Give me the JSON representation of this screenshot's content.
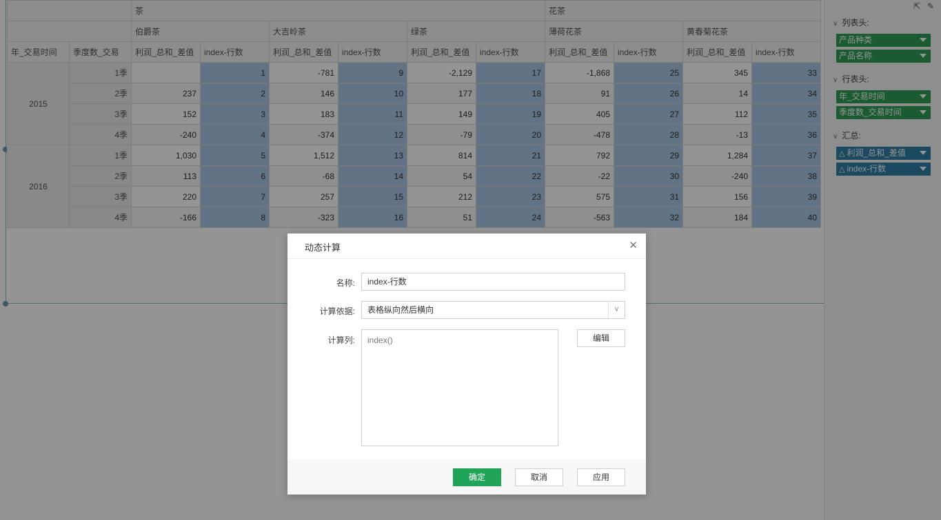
{
  "pivot": {
    "top_groups": [
      "茶",
      "花茶"
    ],
    "products": [
      "伯爵茶",
      "大吉岭茶",
      "绿茶",
      "薄荷花茶",
      "黄春菊花茶"
    ],
    "row_fields": [
      "年_交易时间",
      "季度数_交易"
    ],
    "measure_labels": [
      "利润_总和_差值",
      "index-行数"
    ],
    "years": [
      "2015",
      "2016"
    ],
    "quarters": [
      "1季",
      "2季",
      "3季",
      "4季"
    ],
    "rows": [
      [
        [
          "",
          "1"
        ],
        [
          "-781",
          "9"
        ],
        [
          "-2,129",
          "17"
        ],
        [
          "-1,868",
          "25"
        ],
        [
          "345",
          "33"
        ]
      ],
      [
        [
          "237",
          "2"
        ],
        [
          "146",
          "10"
        ],
        [
          "177",
          "18"
        ],
        [
          "91",
          "26"
        ],
        [
          "14",
          "34"
        ]
      ],
      [
        [
          "152",
          "3"
        ],
        [
          "183",
          "11"
        ],
        [
          "149",
          "19"
        ],
        [
          "405",
          "27"
        ],
        [
          "112",
          "35"
        ]
      ],
      [
        [
          "-240",
          "4"
        ],
        [
          "-374",
          "12"
        ],
        [
          "-79",
          "20"
        ],
        [
          "-478",
          "28"
        ],
        [
          "-13",
          "36"
        ]
      ],
      [
        [
          "1,030",
          "5"
        ],
        [
          "1,512",
          "13"
        ],
        [
          "814",
          "21"
        ],
        [
          "792",
          "29"
        ],
        [
          "1,284",
          "37"
        ]
      ],
      [
        [
          "113",
          "6"
        ],
        [
          "-68",
          "14"
        ],
        [
          "54",
          "22"
        ],
        [
          "-22",
          "30"
        ],
        [
          "-240",
          "38"
        ]
      ],
      [
        [
          "220",
          "7"
        ],
        [
          "257",
          "15"
        ],
        [
          "212",
          "23"
        ],
        [
          "575",
          "31"
        ],
        [
          "156",
          "39"
        ]
      ],
      [
        [
          "-166",
          "8"
        ],
        [
          "-323",
          "16"
        ],
        [
          "51",
          "24"
        ],
        [
          "-563",
          "32"
        ],
        [
          "184",
          "40"
        ]
      ]
    ]
  },
  "sidepanel": {
    "col_header_label": "列表头:",
    "col_fields": [
      "产品种类",
      "产品名称"
    ],
    "row_header_label": "行表头:",
    "row_fields": [
      "年_交易时间",
      "季度数_交易时间"
    ],
    "summary_label": "汇总:",
    "summary_fields": [
      "利润_总和_差值",
      "index-行数"
    ]
  },
  "dialog": {
    "title": "动态计算",
    "name_label": "名称:",
    "name_value": "index-行数",
    "basis_label": "计算依据:",
    "basis_value": "表格纵向然后横向",
    "column_label": "计算列:",
    "column_value": "index()",
    "edit_button": "编辑",
    "ok_button": "确定",
    "cancel_button": "取消",
    "apply_button": "应用"
  },
  "colors": {
    "index_cell": "#a7c6e6",
    "primary_button": "#1fa45a",
    "green_pill": "#2e9d55",
    "blue_pill": "#2e7fa6"
  }
}
